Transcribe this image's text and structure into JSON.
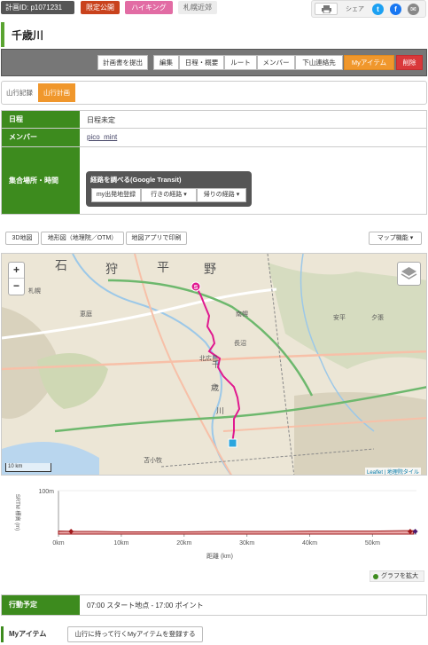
{
  "header": {
    "plan_id": "計画ID: p1071231",
    "tags": [
      "限定公開",
      "ハイキング",
      "札幌近郊"
    ],
    "share_label": "シェア",
    "share_icons": [
      "printer-icon",
      "twitter-icon",
      "facebook-icon",
      "mail-icon"
    ]
  },
  "title": "千歳川",
  "actions": {
    "plan_submit": "計画書を提出",
    "edit": "編集",
    "schedule": "日程・概要",
    "route": "ルート",
    "member": "メンバー",
    "descent": "下山連絡先",
    "myitem": "Myアイテム",
    "delete": "削除"
  },
  "tabs": [
    "山行記録",
    "山行計画"
  ],
  "info": {
    "schedule_label": "日程",
    "schedule_value": "日程未定",
    "member_label": "メンバー",
    "member_value": "pico_mint",
    "meeting_label": "集合場所・時間",
    "transit_title": "経路を調べる(Google Transit)",
    "transit_register": "my出発地登録",
    "transit_go": "行きの経路 ▾",
    "transit_back": "帰りの経路 ▾"
  },
  "map_tools": {
    "btn_3d": "3D地図",
    "btn_gsi": "地形図（地理院／OTM）",
    "btn_app": "地図アプリで印刷",
    "btn_func": "マップ機能 ▾"
  },
  "map": {
    "zoom_in": "+",
    "zoom_out": "−",
    "scale": "10 km",
    "attribution": "Leaflet | 地理院タイル",
    "start_marker": "S",
    "place_labels": [
      "石",
      "狩",
      "平",
      "野",
      "千",
      "歳",
      "川",
      "長沼",
      "南幌",
      "恵庭",
      "北広島",
      "札幌",
      "安平",
      "夕張",
      "苫小牧"
    ]
  },
  "chart_data": {
    "type": "area",
    "ylabel": "SRTM 標高 (m)",
    "xlabel": "距離 (km)",
    "yticks": [
      "100m"
    ],
    "xticks": [
      "0km",
      "10km",
      "20km",
      "30km",
      "40km",
      "50km"
    ],
    "xlim": [
      0,
      57
    ],
    "ylim": [
      0,
      100
    ],
    "series": [
      {
        "x": [
          0,
          3,
          6,
          10,
          15,
          20,
          25,
          30,
          35,
          40,
          45,
          50,
          55,
          56.5
        ],
        "values": [
          7,
          6,
          6,
          5,
          5,
          5,
          6,
          6,
          6,
          7,
          7,
          7,
          8,
          8
        ]
      }
    ],
    "markers": [
      {
        "x": 2,
        "color": "#a0191b"
      },
      {
        "x": 56,
        "color": "#a0191b"
      },
      {
        "x": 56.8,
        "color": "#4a1a6e"
      }
    ]
  },
  "expand_graph": "グラフを拡大",
  "plan": {
    "label": "行動予定",
    "value": "07:00 スタート地点 - 17:00 ポイント"
  },
  "myitem": {
    "label": "Myアイテム",
    "button": "山行に持って行くMyアイテムを登録する"
  }
}
